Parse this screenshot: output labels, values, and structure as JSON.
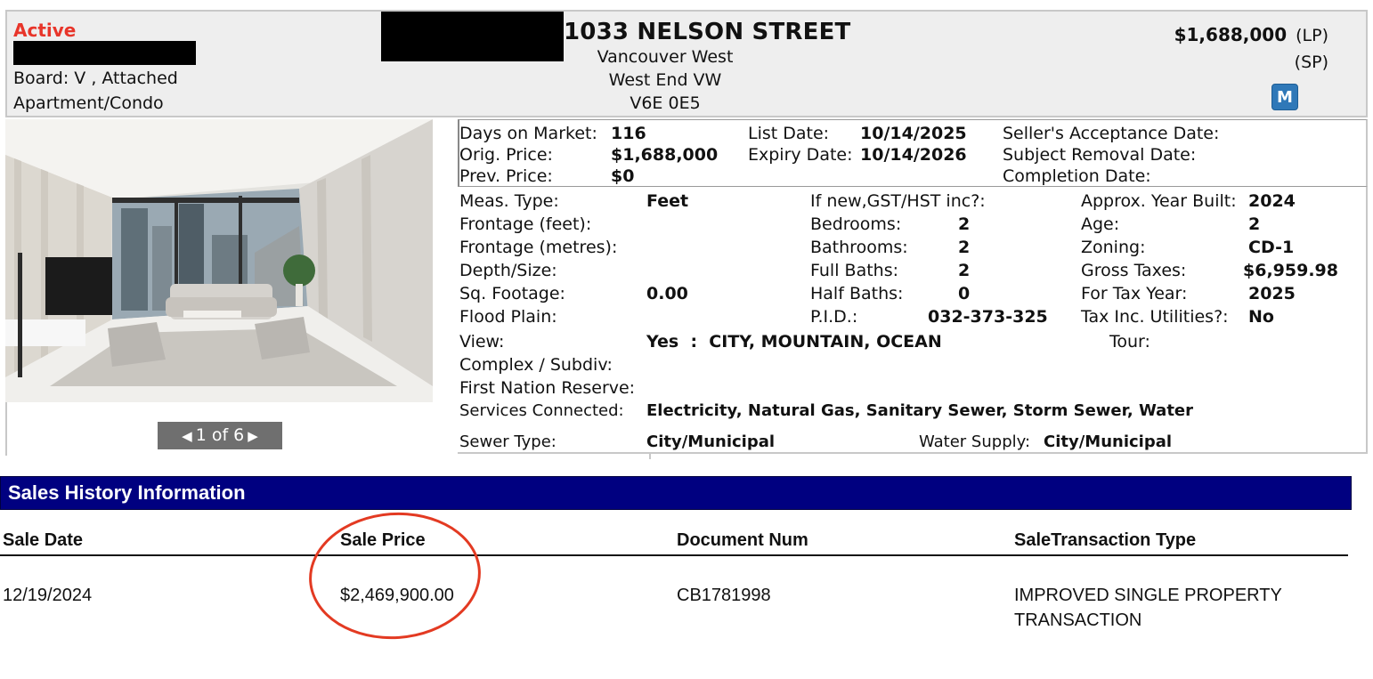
{
  "header": {
    "status": "Active",
    "board": "Board: V , Attached",
    "property_type": "Apartment/Condo",
    "address": "1033 NELSON STREET",
    "area": "Vancouver West",
    "sub_area": "West End VW",
    "postal_code": "V6E 0E5",
    "list_price": "$1,688,000",
    "lp_label": "(LP)",
    "sp_label": "(SP)",
    "badge": "M"
  },
  "photo": {
    "pager_text": "1 of 6",
    "prev_icon": "◀",
    "next_icon": "▶"
  },
  "dates": {
    "dom_label": "Days on Market:",
    "dom_value": "116",
    "orig_label": "Orig. Price:",
    "orig_value": "$1,688,000",
    "prev_label": "Prev. Price:",
    "prev_value": "$0",
    "list_date_label": "List Date:",
    "list_date_value": "10/14/2025",
    "expiry_label": "Expiry Date:",
    "expiry_value": "10/14/2026",
    "seller_accept_label": "Seller's Acceptance Date:",
    "subject_removal_label": "Subject Removal Date:",
    "completion_label": "Completion Date:"
  },
  "details": {
    "meas_label": "Meas. Type:",
    "meas_value": "Feet",
    "frontage_ft_label": "Frontage (feet):",
    "frontage_m_label": "Frontage (metres):",
    "depth_label": "Depth/Size:",
    "sqft_label": "Sq. Footage:",
    "sqft_value": "0.00",
    "flood_label": "Flood Plain:",
    "view_label": "View:",
    "view_value": "Yes  :  CITY, MOUNTAIN, OCEAN",
    "complex_label": "Complex / Subdiv:",
    "first_nation_label": "First Nation Reserve:",
    "services_label": "Services Connected:",
    "services_value": "Electricity, Natural Gas, Sanitary Sewer, Storm Sewer, Water",
    "sewer_label": "Sewer Type:",
    "sewer_value": "City/Municipal",
    "water_label": "Water Supply:",
    "water_value": "City/Municipal",
    "gst_label": "If new,GST/HST inc?:",
    "bedrooms_label": "Bedrooms:",
    "bedrooms_value": "2",
    "bathrooms_label": "Bathrooms:",
    "bathrooms_value": "2",
    "full_baths_label": "Full Baths:",
    "full_baths_value": "2",
    "half_baths_label": "Half Baths:",
    "half_baths_value": "0",
    "pid_label": "P.I.D.:",
    "pid_value": "032-373-325",
    "tour_label": "Tour:",
    "year_built_label": "Approx. Year Built:",
    "year_built_value": "2024",
    "age_label": "Age:",
    "age_value": "2",
    "zoning_label": "Zoning:",
    "zoning_value": "CD-1",
    "gross_taxes_label": "Gross Taxes:",
    "gross_taxes_value": "$6,959.98",
    "tax_year_label": "For Tax Year:",
    "tax_year_value": "2025",
    "tax_utilities_label": "Tax Inc. Utilities?:",
    "tax_utilities_value": "No"
  },
  "sales_history": {
    "title": "Sales History Information",
    "columns": [
      "Sale Date",
      "Sale Price",
      "Document Num",
      "SaleTransaction Type"
    ],
    "rows": [
      {
        "sale_date": "12/19/2024",
        "sale_price": "$2,469,900.00",
        "document_num": "CB1781998",
        "type_line1": "IMPROVED SINGLE PROPERTY",
        "type_line2": "TRANSACTION"
      }
    ]
  },
  "colors": {
    "status_red": "#e8352a",
    "header_bg": "#eeeeee",
    "section_bar": "#000080",
    "annotation_circle": "#e33a22",
    "badge_blue": "#2f78b8"
  }
}
